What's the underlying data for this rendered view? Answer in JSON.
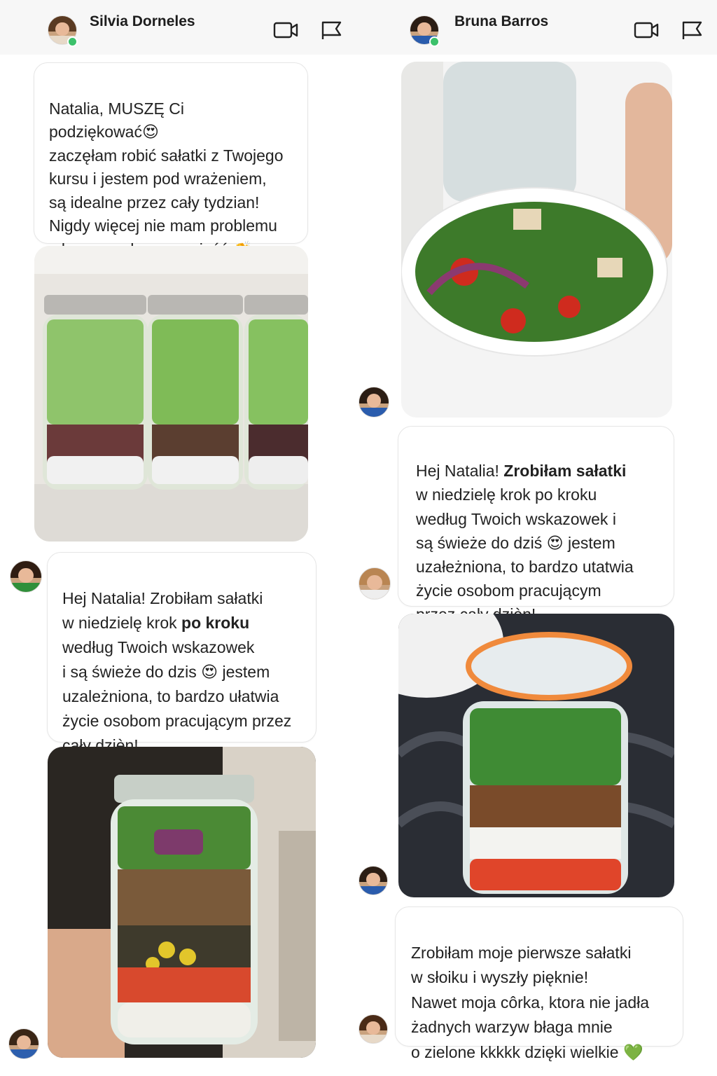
{
  "left_chat": {
    "header": {
      "name": "Silvia Dorneles",
      "online": true,
      "video_icon": "video-camera-icon",
      "flag_icon": "flag-icon"
    },
    "messages": [
      {
        "type": "text",
        "text": "Natalia, MUSZĘ Ci\npodziękować😍\nzaczęłam robić sałatki z Twojego\nkursu i jestem pod wrażeniem,\nsą idealne przez cały tydzian!\nNigdy więcej nie mam problemu\nz łym, co zdrowego zjeść 👏"
      },
      {
        "type": "image",
        "label": "three salad jars"
      },
      {
        "type": "text",
        "before": "Hej Natalia! Zrobiłam sałatki\nw niedzielę krok ",
        "highlight": "po kroku",
        "after": "\nwedług Twoich wskazowek\ni są świeże do dzis 😍 jestem\nuzależniona, to bardzo ułatwia\nżycie osobom pracującym przez\ncały dzièn!"
      },
      {
        "type": "image",
        "label": "hand holding salad jar"
      }
    ]
  },
  "right_chat": {
    "header": {
      "name": "Bruna Barros",
      "online": true,
      "video_icon": "video-camera-icon",
      "flag_icon": "flag-icon"
    },
    "messages": [
      {
        "type": "image",
        "label": "salad bowl with dressing jar"
      },
      {
        "type": "text",
        "before": "Hej Natalia! ",
        "highlight": "Zrobiłam sałatki",
        "after": "\nw niedzielę krok po kroku\nwedług Twoich wskazowek i\nsą świeże do dziś 😍 jestem\nuzałeżniona, to bardzo utatwia\nżycie osobom pracującym\nprzez cały dzièn!"
      },
      {
        "type": "image",
        "label": "glass jar with clamp lid"
      },
      {
        "type": "text",
        "text": "Zrobiłam moje pierwsze sałatki\nw słoiku i wyszły pięknie!\nNawet moja côrka, ktora nie jadła\nżadnych warzyw błaga mnie\no zielone kkkkk dzięki wielkie 💚"
      }
    ]
  }
}
